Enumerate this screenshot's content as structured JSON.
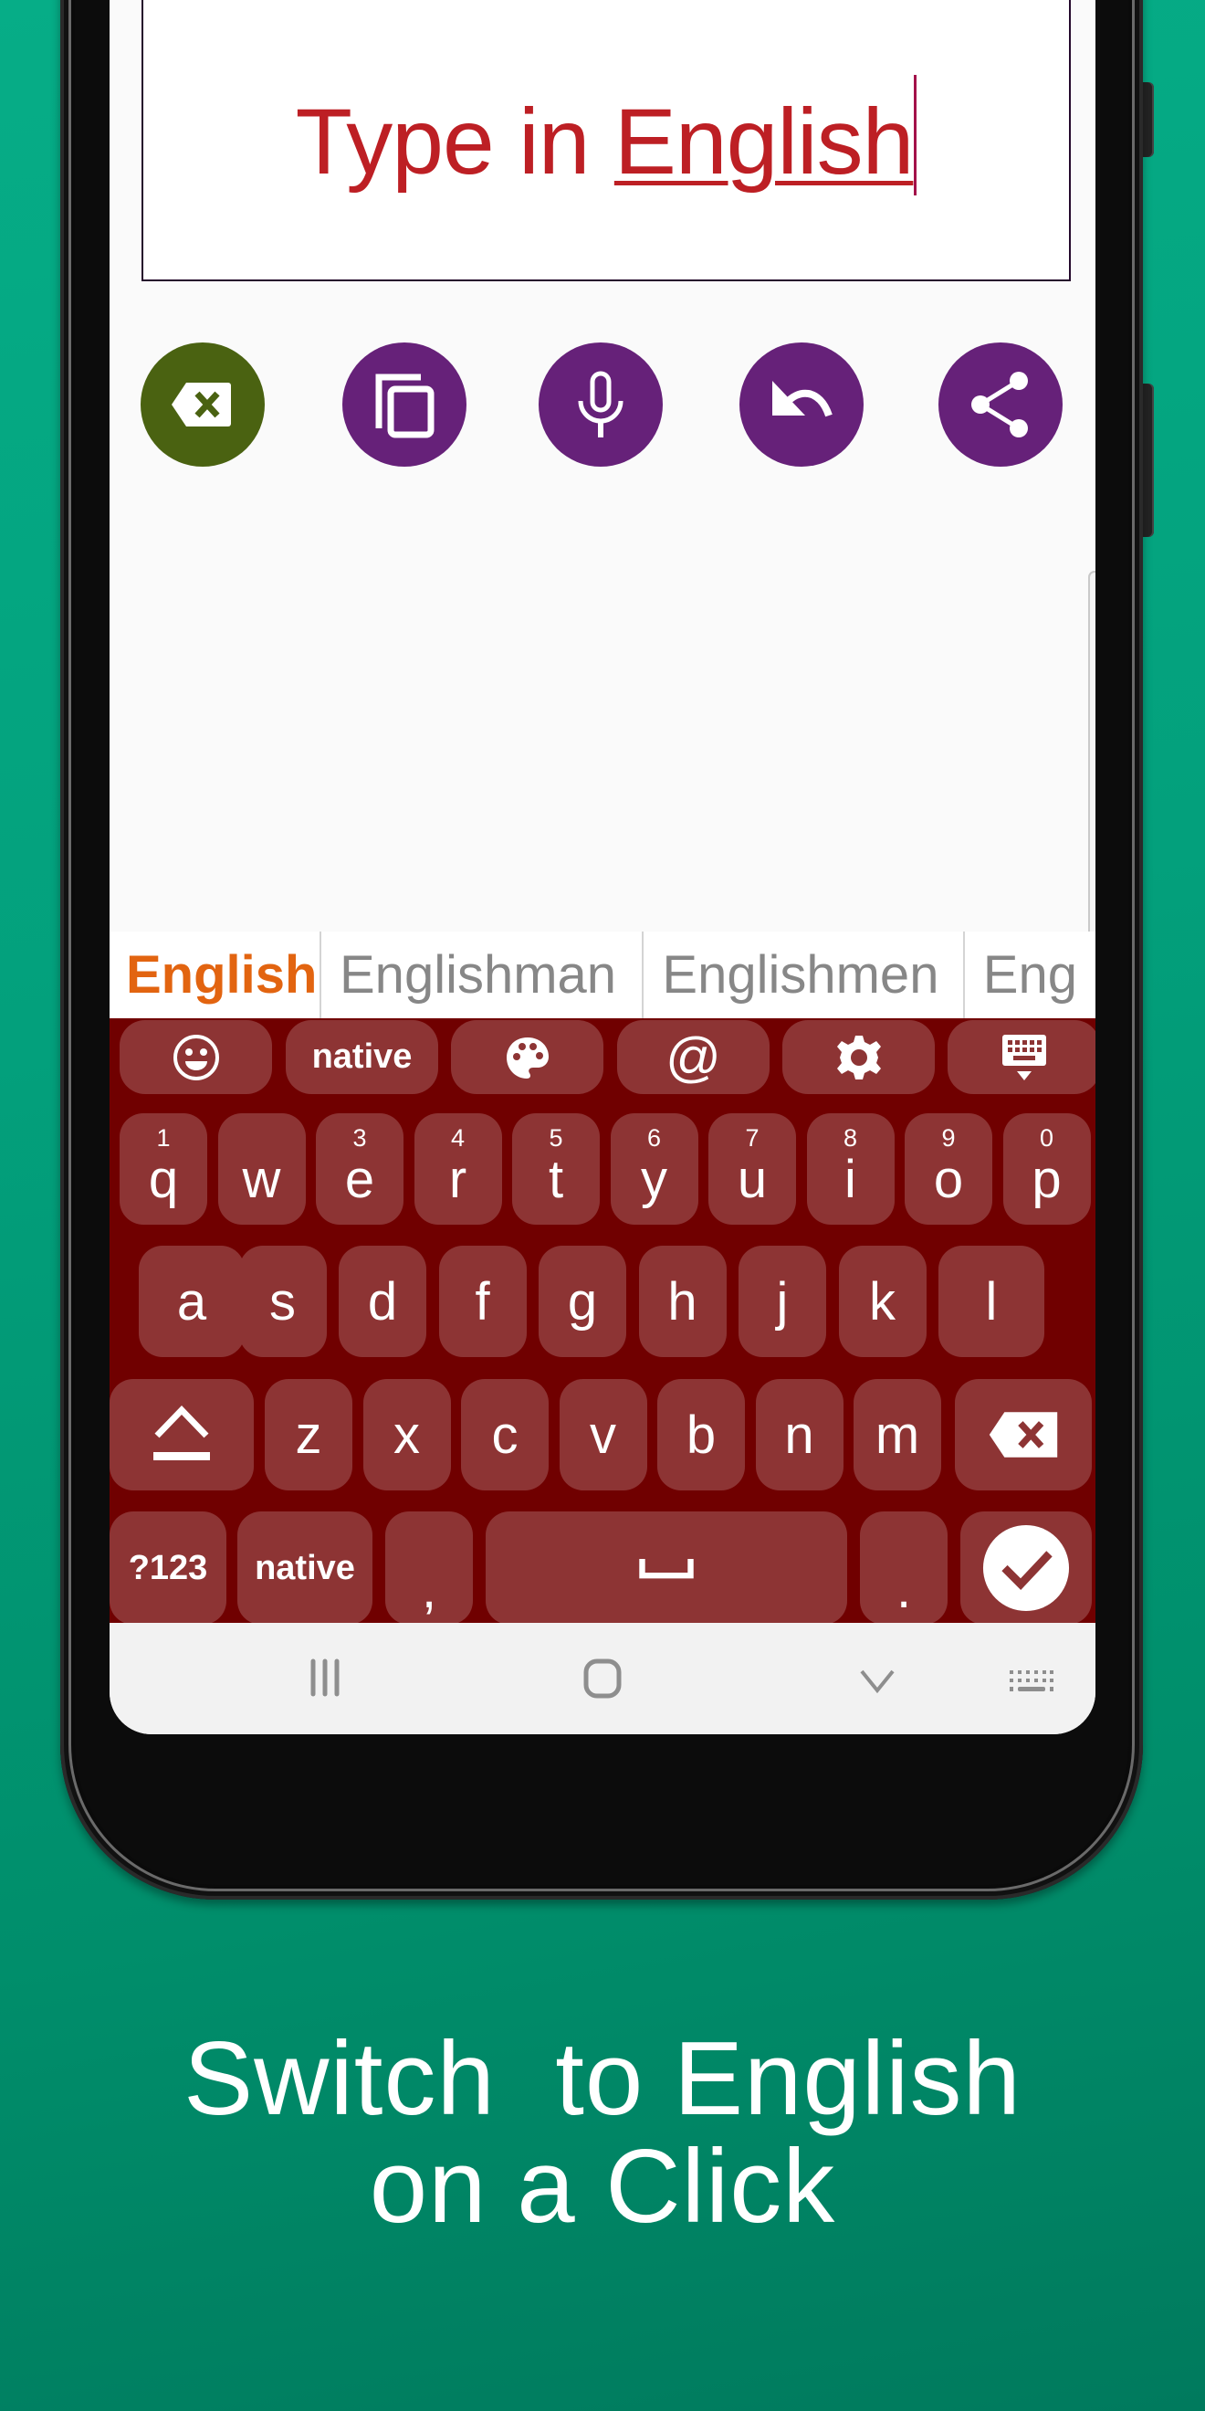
{
  "input": {
    "text_plain": "Type in ",
    "text_composing": "English"
  },
  "action_buttons": [
    {
      "name": "clear-button",
      "icon": "backspace-clear-icon",
      "color": "#4a6211"
    },
    {
      "name": "copy-button",
      "icon": "copy-icon",
      "color": "#662179"
    },
    {
      "name": "mic-button",
      "icon": "microphone-icon",
      "color": "#662179"
    },
    {
      "name": "undo-button",
      "icon": "undo-icon",
      "color": "#662179"
    },
    {
      "name": "share-button",
      "icon": "share-icon",
      "color": "#662179"
    }
  ],
  "suggestions": [
    "English",
    "Englishman",
    "Englishmen",
    "Eng"
  ],
  "keyboard": {
    "toolbar": {
      "emoji": "emoji-icon",
      "native_label": "native",
      "theme": "palette-icon",
      "at_label": "@",
      "settings": "gear-icon",
      "hide": "keyboard-hide-icon"
    },
    "row1": [
      {
        "key": "q",
        "hint": "1"
      },
      {
        "key": "w",
        "hint": ""
      },
      {
        "key": "e",
        "hint": "3"
      },
      {
        "key": "r",
        "hint": "4"
      },
      {
        "key": "t",
        "hint": "5"
      },
      {
        "key": "y",
        "hint": "6"
      },
      {
        "key": "u",
        "hint": "7"
      },
      {
        "key": "i",
        "hint": "8"
      },
      {
        "key": "o",
        "hint": "9"
      },
      {
        "key": "p",
        "hint": "0"
      }
    ],
    "row2": [
      "a",
      "s",
      "d",
      "f",
      "g",
      "h",
      "j",
      "k",
      "l"
    ],
    "row3": [
      "z",
      "x",
      "c",
      "v",
      "b",
      "n",
      "m"
    ],
    "row4": {
      "symbols_label": "?123",
      "native_label": "native",
      "comma": ",",
      "period": "."
    },
    "colors": {
      "background": "#700000",
      "key": "#8d3434",
      "suggestion_primary": "#e26410"
    }
  },
  "caption": {
    "line1": "Switch  to English",
    "line2": "on a Click"
  }
}
